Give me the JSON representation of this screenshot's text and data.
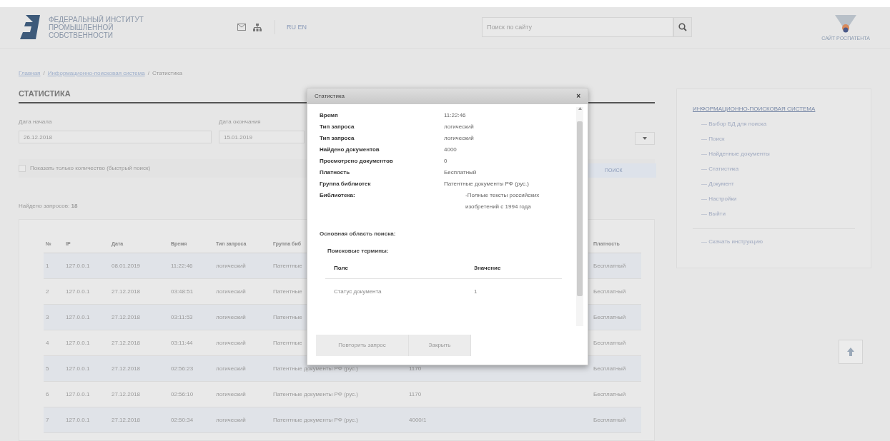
{
  "header": {
    "logo_text": "ФЕДЕРАЛЬНЫЙ ИНСТИТУТ ПРОМЫШЛЕННОЙ СОБСТВЕННОСТИ",
    "languages": "RU EN",
    "search": {
      "placeholder": "Поиск по сайту"
    },
    "partner_caption": "САЙТ РОСПАТЕНТА"
  },
  "breadcrumb_separator": "/",
  "breadcrumbs": [
    {
      "label": "Главная",
      "link": true
    },
    {
      "label": "Информационно-поисковая система",
      "link": true
    },
    {
      "label": "Статистика",
      "link": false
    }
  ],
  "page_title": "СТАТИСТИКА",
  "filters": {
    "start_label": "Дата начала",
    "start_value": "26.12.2018",
    "end_label": "Дата окончания",
    "end_value": "15.01.2019",
    "quick_checkbox": {
      "label": "Показать только количество (быстрый поиск)",
      "checked": false
    },
    "search_button": "ПОИСК"
  },
  "found_text": "Найдено запросов: **18**",
  "table": {
    "columns": [
      "№",
      "IP",
      "Дата",
      "Время",
      "Тип запроса",
      "Группа биб",
      "",
      "Платность"
    ],
    "rows": [
      [
        "1",
        "127.0.0.1",
        "08.01.2019",
        "11:22:46",
        "логический",
        "Патентные",
        "",
        "Бесплатный"
      ],
      [
        "2",
        "127.0.0.1",
        "27.12.2018",
        "03:48:51",
        "логический",
        "Патентные",
        "",
        "Бесплатный"
      ],
      [
        "3",
        "127.0.0.1",
        "27.12.2018",
        "03:11:53",
        "логический",
        "Патентные",
        "",
        "Бесплатный"
      ],
      [
        "4",
        "127.0.0.1",
        "27.12.2018",
        "03:11:44",
        "логический",
        "Патентные",
        "",
        "Бесплатный"
      ],
      [
        "5",
        "127.0.0.1",
        "27.12.2018",
        "02:56:23",
        "логический",
        "Патентные документы РФ (рус.)",
        "1170",
        "Бесплатный"
      ],
      [
        "6",
        "127.0.0.1",
        "27.12.2018",
        "02:56:10",
        "логический",
        "Патентные документы РФ (рус.)",
        "1170",
        "Бесплатный"
      ],
      [
        "7",
        "127.0.0.1",
        "27.12.2018",
        "02:50:34",
        "логический",
        "Патентные документы РФ (рус.)",
        "4000/1",
        "Бесплатный"
      ]
    ]
  },
  "sidebar": {
    "title": "ИНФОРМАЦИОННО-ПОИСКОВАЯ СИСТЕМА",
    "items": [
      "— Выбор БД для поиска",
      "— Поиск",
      "— Найденные документы",
      "— Статистика",
      "— Документ",
      "— Настройки",
      "— Выйти"
    ],
    "download": "— Скачать инструкцию"
  },
  "dialog": {
    "title": "Статистика",
    "close": "×",
    "fields": [
      {
        "label": "Время",
        "value": "11:22:46",
        "indent": false
      },
      {
        "label": "Тип запроса",
        "value": "логический",
        "indent": false
      },
      {
        "label": "Тип запроса",
        "value": "логический",
        "indent": false
      },
      {
        "label": "Найдено документов",
        "value": "4000",
        "indent": false
      },
      {
        "label": "Просмотрено документов",
        "value": "0",
        "indent": false
      },
      {
        "label": "Платность",
        "value": "Бесплатный",
        "indent": false
      },
      {
        "label": "Группа библиотек",
        "value": "Патентные документы РФ (рус.)",
        "indent": false
      },
      {
        "label": "Библиотека:",
        "value": "-Полные тексты российских изобретений с 1994 года",
        "indent": true
      }
    ],
    "area_title": "Основная область поиска:",
    "terms_title": "Поисковые термины:",
    "terms_columns": [
      "Поле",
      "Значение"
    ],
    "terms_rows": [
      [
        "Статус документа",
        "1"
      ]
    ],
    "buttons": [
      "Повторить запрос",
      "Закрыть"
    ]
  }
}
